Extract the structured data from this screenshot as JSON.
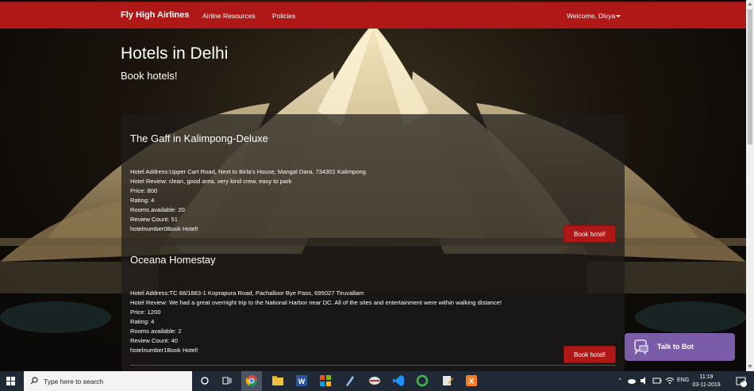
{
  "navbar": {
    "brand": "Fly High Airlines",
    "links": [
      "Airline Resources",
      "Policies"
    ],
    "welcome": "Welcome, Divya"
  },
  "header": {
    "title": "Hotels in Delhi",
    "subtitle": "Book hotels!"
  },
  "hotels": [
    {
      "name": "The Gaff in Kalimpong-Deluxe",
      "address": "Hotel Address:Upper Cart Road, Next to Birla's House, Mangal Dara, 734301 Kalimpong",
      "review": "Hotel Review: clean, good area, very kind crew, easy to park",
      "price": "Price: 800",
      "rating": "Rating: 4",
      "rooms": "Rooms available: 20",
      "review_count": "Review Count: 51",
      "footer": "hotelnumber0Book Hotel!",
      "button": "Book hotel!"
    },
    {
      "name": "Oceana Homestay",
      "address": "Hotel Address:TC 68/1883-1 Koprapura Road, Pachalloor Bye Pass, 695027 Tiruvallam",
      "review": "Hotel Review: We had a great overnight trip to the National Harbor near DC. All of the sites and entertainment were within walking distance!",
      "price": "Price: 1200",
      "rating": "Rating: 4",
      "rooms": "Rooms available: 2",
      "review_count": "Review Count: 40",
      "footer": "hotelnumber1Book Hotel!",
      "button": "Book hotel!"
    }
  ],
  "chatbot": {
    "label": "Talk to Bot"
  },
  "taskbar": {
    "search_placeholder": "Type here to search",
    "language": "ENG",
    "time": "11:19",
    "date": "03-11-2019",
    "notifications": "2",
    "pinned_icons": [
      "task-view-icon",
      "chrome-icon",
      "file-explorer-icon",
      "word-icon",
      "store-icon",
      "notepad-icon",
      "app-icon",
      "vscode-icon",
      "circle-app-icon",
      "editor-icon",
      "xampp-icon"
    ]
  },
  "colors": {
    "navbar": "#b01818",
    "button": "#b01818",
    "chatbot": "#7b5ca8",
    "taskbar": "#1f2a36"
  }
}
